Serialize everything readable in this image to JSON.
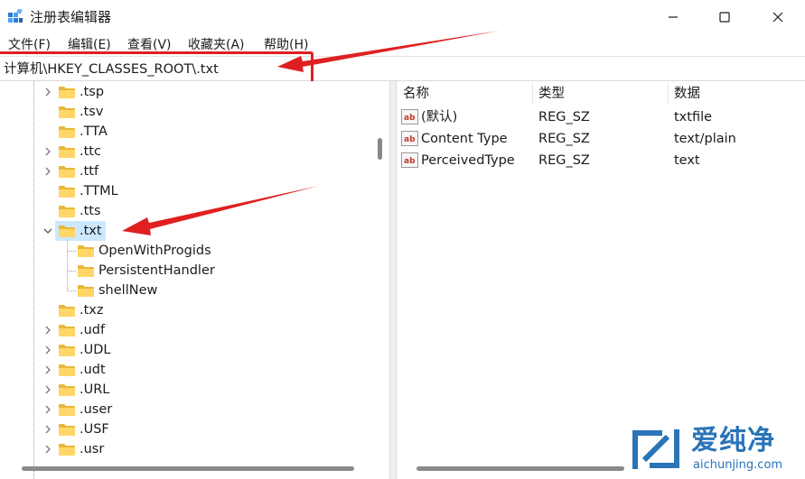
{
  "window": {
    "title": "注册表编辑器",
    "minimize_glyph": "—",
    "maximize_glyph": "☐",
    "close_glyph": "✕"
  },
  "menu": [
    "文件(F)",
    "编辑(E)",
    "查看(V)",
    "收藏夹(A)",
    "帮助(H)"
  ],
  "address": {
    "path": "计算机\\HKEY_CLASSES_ROOT\\.txt"
  },
  "tree": {
    "selected": ".txt",
    "items": [
      {
        "label": ".tsp",
        "expandable": true,
        "depth": 1
      },
      {
        "label": ".tsv",
        "expandable": false,
        "depth": 1
      },
      {
        "label": ".TTA",
        "expandable": false,
        "depth": 1
      },
      {
        "label": ".ttc",
        "expandable": true,
        "depth": 1
      },
      {
        "label": ".ttf",
        "expandable": true,
        "depth": 1
      },
      {
        "label": ".TTML",
        "expandable": false,
        "depth": 1
      },
      {
        "label": ".tts",
        "expandable": false,
        "depth": 1
      },
      {
        "label": ".txt",
        "expandable": true,
        "expanded": true,
        "depth": 1
      },
      {
        "label": "OpenWithProgids",
        "expandable": false,
        "depth": 2
      },
      {
        "label": "PersistentHandler",
        "expandable": false,
        "depth": 2
      },
      {
        "label": "shellNew",
        "expandable": false,
        "depth": 2
      },
      {
        "label": ".txz",
        "expandable": false,
        "depth": 1
      },
      {
        "label": ".udf",
        "expandable": true,
        "depth": 1
      },
      {
        "label": ".UDL",
        "expandable": true,
        "depth": 1
      },
      {
        "label": ".udt",
        "expandable": true,
        "depth": 1
      },
      {
        "label": ".URL",
        "expandable": true,
        "depth": 1
      },
      {
        "label": ".user",
        "expandable": true,
        "depth": 1
      },
      {
        "label": ".USF",
        "expandable": true,
        "depth": 1
      },
      {
        "label": ".usr",
        "expandable": true,
        "depth": 1
      }
    ]
  },
  "values": {
    "columns": {
      "name": "名称",
      "type": "类型",
      "data": "数据"
    },
    "rows": [
      {
        "name": "(默认)",
        "type": "REG_SZ",
        "data": "txtfile"
      },
      {
        "name": "Content Type",
        "type": "REG_SZ",
        "data": "text/plain"
      },
      {
        "name": "PerceivedType",
        "type": "REG_SZ",
        "data": "text"
      }
    ]
  },
  "watermark": {
    "title": "爱纯净",
    "url": "aichunjing.com"
  },
  "colors": {
    "annotation_red": "#e02020",
    "folder_yellow": "#ffd667",
    "selection": "#cce8ff",
    "watermark_blue": "#2a74b8"
  },
  "icons": {
    "app": "regedit-icon",
    "folder": "folder-icon",
    "string_value": "ab-string-icon"
  }
}
